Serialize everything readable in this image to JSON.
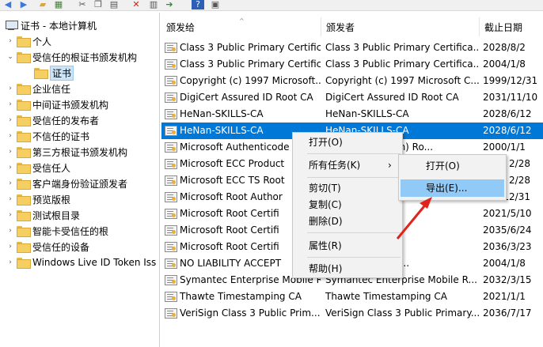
{
  "toolbar": {
    "buttons": [
      "back-arrow-icon",
      "forward-arrow-icon",
      "up-folder-icon",
      "tree-toggle-icon",
      "cut-icon",
      "copy-icon",
      "delete-icon",
      "properties-icon",
      "export-list-icon",
      "help-icon",
      "view-icon"
    ]
  },
  "tree": {
    "root": "证书 - 本地计算机",
    "items": [
      {
        "label": "个人",
        "expander": "›"
      },
      {
        "label": "受信任的根证书颁发机构",
        "expander": "⌄"
      },
      {
        "label": "证书",
        "expander": ""
      },
      {
        "label": "企业信任",
        "expander": "›"
      },
      {
        "label": "中间证书颁发机构",
        "expander": "›"
      },
      {
        "label": "受信任的发布者",
        "expander": "›"
      },
      {
        "label": "不信任的证书",
        "expander": "›"
      },
      {
        "label": "第三方根证书颁发机构",
        "expander": "›"
      },
      {
        "label": "受信任人",
        "expander": "›"
      },
      {
        "label": "客户端身份验证颁发者",
        "expander": "›"
      },
      {
        "label": "预览版根",
        "expander": "›"
      },
      {
        "label": "测试根目录",
        "expander": "›"
      },
      {
        "label": "智能卡受信任的根",
        "expander": "›"
      },
      {
        "label": "受信任的设备",
        "expander": "›"
      },
      {
        "label": "Windows Live ID Token Iss",
        "expander": "›"
      }
    ]
  },
  "list": {
    "headers": [
      "颁发给",
      "颁发者",
      "截止日期"
    ],
    "rows": [
      [
        "Class 3 Public Primary Certific...",
        "Class 3 Public Primary Certifica...",
        "2028/8/2"
      ],
      [
        "Class 3 Public Primary Certific...",
        "Class 3 Public Primary Certifica...",
        "2004/1/8"
      ],
      [
        "Copyright (c) 1997 Microsoft...",
        "Copyright (c) 1997 Microsoft C...",
        "1999/12/31"
      ],
      [
        "DigiCert Assured ID Root CA",
        "DigiCert Assured ID Root CA",
        "2031/11/10"
      ],
      [
        "HeNan-SKILLS-CA",
        "HeNan-SKILLS-CA",
        "2028/6/12"
      ],
      [
        "HeNan-SKILLS-CA",
        "HeNan-SKILLS-CA",
        "2028/6/12"
      ],
      [
        "Microsoft Authenticode",
        "Authenticode(tm) Ro...",
        "2000/1/1"
      ],
      [
        "Microsoft ECC Product",
        "",
        "2/28"
      ],
      [
        "Microsoft ECC TS Root",
        "",
        "2/28"
      ],
      [
        "Microsoft Root Author",
        "",
        "12/31"
      ],
      [
        "Microsoft Root Certifi",
        "Certificate Aut...",
        "2021/5/10"
      ],
      [
        "Microsoft Root Certifi",
        "Certificate Aut...",
        "2035/6/24"
      ],
      [
        "Microsoft Root Certifi",
        "Certificate Aut...",
        "2036/3/23"
      ],
      [
        "NO LIABILITY ACCEPT",
        "CCEPTED, (c)97...",
        "2004/1/8"
      ],
      [
        "Symantec Enterprise Mobile R...",
        "Symantec Enterprise Mobile R...",
        "2032/3/15"
      ],
      [
        "Thawte Timestamping CA",
        "Thawte Timestamping CA",
        "2021/1/1"
      ],
      [
        "VeriSign Class 3 Public Prim...",
        "VeriSign Class 3 Public Primary...",
        "2036/7/17"
      ]
    ],
    "selected_row": 5
  },
  "context_menu": {
    "items": [
      {
        "label": "打开(O)"
      },
      {
        "label": "所有任务(K)",
        "submenu_arrow": "›"
      },
      {
        "label": "剪切(T)"
      },
      {
        "label": "复制(C)"
      },
      {
        "label": "删除(D)"
      },
      {
        "label": "属性(R)"
      },
      {
        "label": "帮助(H)"
      }
    ]
  },
  "submenu": {
    "items": [
      {
        "label": "打开(O)"
      },
      {
        "label": "导出(E)..."
      }
    ],
    "highlighted": 1
  },
  "colors": {
    "selection": "#0078d7",
    "menu_highlight": "#91c9f7",
    "annotation_arrow": "#e0241b"
  }
}
